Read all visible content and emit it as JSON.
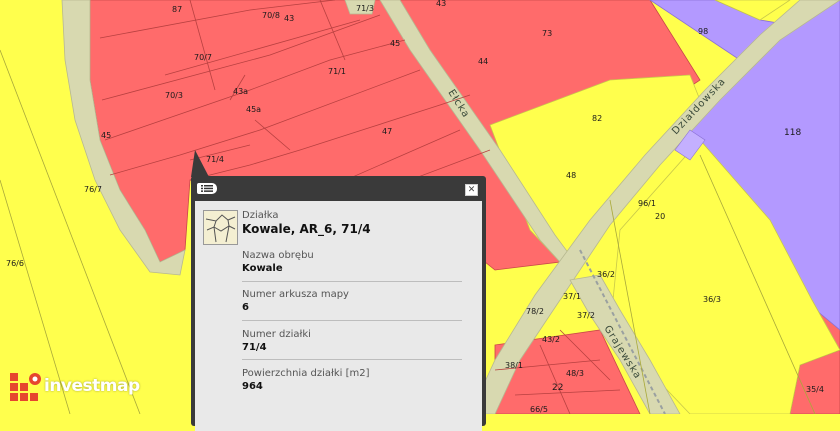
{
  "map": {
    "streets": [
      "Ełcka",
      "Działdowska",
      "Grajewska"
    ],
    "parcel_labels": [
      "87",
      "70/8",
      "43",
      "71/3",
      "43",
      "70/7",
      "45",
      "73",
      "44",
      "70/3",
      "43a",
      "71/1",
      "45a",
      "47",
      "71/4",
      "45",
      "76/7",
      "76/6",
      "98",
      "118",
      "82",
      "48",
      "20",
      "96/1",
      "36/2",
      "37/1",
      "36/3",
      "78/2",
      "37/2",
      "43/2",
      "22",
      "48/3",
      "38/1",
      "66/5",
      "35/4"
    ],
    "colors": {
      "residential": "#ff6b6b",
      "agricultural": "#ffff4d",
      "road": "#d8d9b0",
      "service": "#b399ff"
    }
  },
  "popup": {
    "menu_icon": "list-icon",
    "close_icon": "close-icon",
    "parcel_icon": "parcel-map-icon",
    "header_label": "Działka",
    "header_value": "Kowale, AR_6, 71/4",
    "fields": [
      {
        "label": "Nazwa obrębu",
        "value": "Kowale"
      },
      {
        "label": "Numer arkusza mapy",
        "value": "6"
      },
      {
        "label": "Numer działki",
        "value": "71/4"
      },
      {
        "label": "Powierzchnia działki [m2]",
        "value": "964"
      }
    ]
  },
  "brand": {
    "name": "investmap",
    "logo": "investmap-logo-icon"
  }
}
